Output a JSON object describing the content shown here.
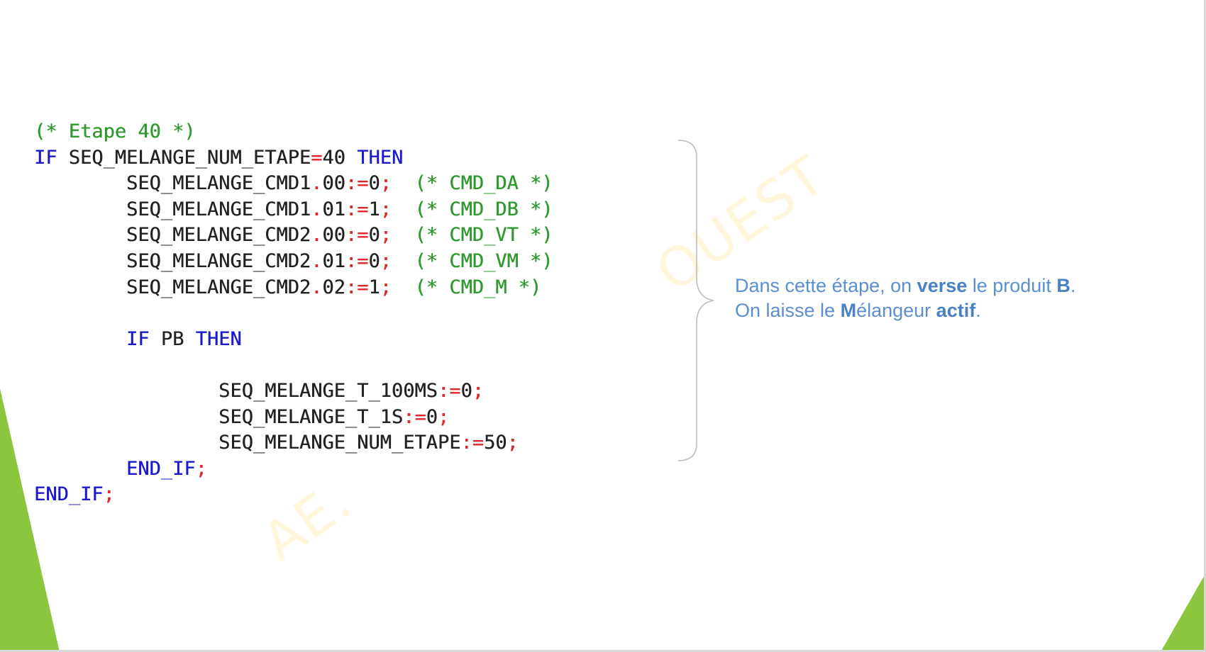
{
  "code": {
    "lines": [
      [
        {
          "t": "(* Etape 40 *)",
          "c": "cm"
        }
      ],
      [
        {
          "t": "IF",
          "c": "kw"
        },
        {
          "t": " SEQ_MELANGE_NUM_ETAPE",
          "c": "id"
        },
        {
          "t": "=",
          "c": "op"
        },
        {
          "t": "40 ",
          "c": "nm"
        },
        {
          "t": "THEN",
          "c": "kw"
        }
      ],
      [
        {
          "t": "        SEQ_MELANGE_CMD1",
          "c": "id"
        },
        {
          "t": ".",
          "c": "op"
        },
        {
          "t": "00",
          "c": "nm"
        },
        {
          "t": ":=",
          "c": "op"
        },
        {
          "t": "0",
          "c": "nm"
        },
        {
          "t": ";",
          "c": "op"
        },
        {
          "t": "  (* CMD_DA *)",
          "c": "cm"
        }
      ],
      [
        {
          "t": "        SEQ_MELANGE_CMD1",
          "c": "id"
        },
        {
          "t": ".",
          "c": "op"
        },
        {
          "t": "01",
          "c": "nm"
        },
        {
          "t": ":=",
          "c": "op"
        },
        {
          "t": "1",
          "c": "nm"
        },
        {
          "t": ";",
          "c": "op"
        },
        {
          "t": "  (* CMD_DB *)",
          "c": "cm"
        }
      ],
      [
        {
          "t": "        SEQ_MELANGE_CMD2",
          "c": "id"
        },
        {
          "t": ".",
          "c": "op"
        },
        {
          "t": "00",
          "c": "nm"
        },
        {
          "t": ":=",
          "c": "op"
        },
        {
          "t": "0",
          "c": "nm"
        },
        {
          "t": ";",
          "c": "op"
        },
        {
          "t": "  (* CMD_VT *)",
          "c": "cm"
        }
      ],
      [
        {
          "t": "        SEQ_MELANGE_CMD2",
          "c": "id"
        },
        {
          "t": ".",
          "c": "op"
        },
        {
          "t": "01",
          "c": "nm"
        },
        {
          "t": ":=",
          "c": "op"
        },
        {
          "t": "0",
          "c": "nm"
        },
        {
          "t": ";",
          "c": "op"
        },
        {
          "t": "  (* CMD_VM *)",
          "c": "cm"
        }
      ],
      [
        {
          "t": "        SEQ_MELANGE_CMD2",
          "c": "id"
        },
        {
          "t": ".",
          "c": "op"
        },
        {
          "t": "02",
          "c": "nm"
        },
        {
          "t": ":=",
          "c": "op"
        },
        {
          "t": "1",
          "c": "nm"
        },
        {
          "t": ";",
          "c": "op"
        },
        {
          "t": "  (* CMD_M *)",
          "c": "cm"
        }
      ],
      [],
      [
        {
          "t": "        IF",
          "c": "kw"
        },
        {
          "t": " PB ",
          "c": "id"
        },
        {
          "t": "THEN",
          "c": "kw"
        }
      ],
      [],
      [
        {
          "t": "                SEQ_MELANGE_T_100MS",
          "c": "id"
        },
        {
          "t": ":=",
          "c": "op"
        },
        {
          "t": "0",
          "c": "nm"
        },
        {
          "t": ";",
          "c": "op"
        }
      ],
      [
        {
          "t": "                SEQ_MELANGE_T_1S",
          "c": "id"
        },
        {
          "t": ":=",
          "c": "op"
        },
        {
          "t": "0",
          "c": "nm"
        },
        {
          "t": ";",
          "c": "op"
        }
      ],
      [
        {
          "t": "                SEQ_MELANGE_NUM_ETAPE",
          "c": "id"
        },
        {
          "t": ":=",
          "c": "op"
        },
        {
          "t": "50",
          "c": "nm"
        },
        {
          "t": ";",
          "c": "op"
        }
      ],
      [
        {
          "t": "        END_IF",
          "c": "kw"
        },
        {
          "t": ";",
          "c": "op"
        }
      ],
      [
        {
          "t": "END_IF",
          "c": "kw"
        },
        {
          "t": ";",
          "c": "op"
        }
      ]
    ]
  },
  "note": {
    "line1": {
      "p1": "Dans cette étape, on ",
      "b1": "verse",
      "p2": " le produit ",
      "b2": "B",
      "p3": "."
    },
    "line2": {
      "p1": "On laisse le ",
      "b1": "M",
      "p2": "élangeur ",
      "b2": "actif",
      "p3": "."
    }
  },
  "watermark": {
    "text1": "OUEST",
    "text2": "AE."
  },
  "colors": {
    "keyword": "#1a1acc",
    "comment": "#2e9a2e",
    "operator": "#e0252b",
    "identifier": "#222222",
    "note": "#5b8fd0",
    "accent_green": "#8cc63f"
  }
}
